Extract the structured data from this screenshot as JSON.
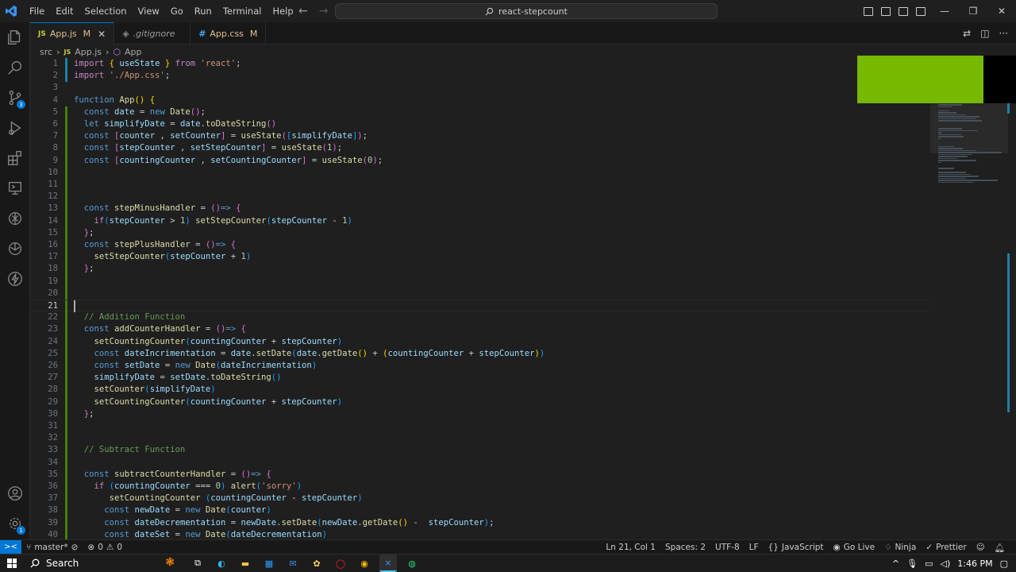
{
  "titlebar": {
    "menu": [
      "File",
      "Edit",
      "Selection",
      "View",
      "Go",
      "Run",
      "Terminal",
      "Help"
    ],
    "search_text": "react-stepcount"
  },
  "activitybar": {
    "icons": [
      "explorer-icon",
      "search-icon",
      "source-control-icon",
      "run-debug-icon",
      "extensions-icon",
      "remote-explorer-icon",
      "chatgpt-icon",
      "copilot-icon",
      "thunder-client-icon"
    ],
    "source_control_badge": "3",
    "bottom_icons": [
      "account-icon",
      "manage-gear-icon"
    ]
  },
  "tabs": [
    {
      "label": "App.js",
      "type": "JS",
      "modified": "M",
      "active": true
    },
    {
      "label": ".gitignore",
      "type": "git",
      "modified": "",
      "active": false
    },
    {
      "label": "App.css",
      "type": "#",
      "modified": "M",
      "active": false
    }
  ],
  "breadcrumb": {
    "folder": "src",
    "file": "App.js",
    "symbol": "App"
  },
  "editor": {
    "cursor_line": 21,
    "lines": [
      {
        "n": "1",
        "g": "mod",
        "t": [
          [
            "import ",
            "kw2"
          ],
          [
            "{ ",
            "br1"
          ],
          [
            "useState",
            "var"
          ],
          [
            " }",
            "br1"
          ],
          [
            " from ",
            "kw2"
          ],
          [
            "'react'",
            "str"
          ],
          [
            ";",
            "pn"
          ]
        ]
      },
      {
        "n": "2",
        "g": "mod",
        "t": [
          [
            "import ",
            "kw2"
          ],
          [
            "'./App.css'",
            "str"
          ],
          [
            ";",
            "pn"
          ]
        ]
      },
      {
        "n": "3",
        "g": "",
        "t": []
      },
      {
        "n": "4",
        "g": "",
        "t": [
          [
            "function ",
            "kw"
          ],
          [
            "App",
            "fn"
          ],
          [
            "() ",
            "br1"
          ],
          [
            "{",
            "br1"
          ]
        ]
      },
      {
        "n": "5",
        "g": "add",
        "t": [
          [
            "  const ",
            "kw"
          ],
          [
            "date",
            "var"
          ],
          [
            " = ",
            "pn"
          ],
          [
            "new ",
            "kw"
          ],
          [
            "Date",
            "fn"
          ],
          [
            "()",
            "br2"
          ],
          [
            ";",
            "pn"
          ]
        ]
      },
      {
        "n": "6",
        "g": "add",
        "t": [
          [
            "  let ",
            "kw"
          ],
          [
            "simplifyDate",
            "var"
          ],
          [
            " = ",
            "pn"
          ],
          [
            "date",
            "var"
          ],
          [
            ".",
            "pn"
          ],
          [
            "toDateString",
            "fn"
          ],
          [
            "()",
            "br2"
          ]
        ]
      },
      {
        "n": "7",
        "g": "add",
        "t": [
          [
            "  const ",
            "kw"
          ],
          [
            "[",
            "br2"
          ],
          [
            "counter",
            "var"
          ],
          [
            " , ",
            "pn"
          ],
          [
            "setCounter",
            "var"
          ],
          [
            "]",
            "br2"
          ],
          [
            " = ",
            "pn"
          ],
          [
            "useState",
            "fn"
          ],
          [
            "(",
            "br2"
          ],
          [
            "[",
            "br3"
          ],
          [
            "simplifyDate",
            "var"
          ],
          [
            "]",
            "br3"
          ],
          [
            ")",
            "br2"
          ],
          [
            ";",
            "pn"
          ]
        ]
      },
      {
        "n": "8",
        "g": "add",
        "t": [
          [
            "  const ",
            "kw"
          ],
          [
            "[",
            "br2"
          ],
          [
            "stepCounter",
            "var"
          ],
          [
            " , ",
            "pn"
          ],
          [
            "setStepCounter",
            "var"
          ],
          [
            "]",
            "br2"
          ],
          [
            " = ",
            "pn"
          ],
          [
            "useState",
            "fn"
          ],
          [
            "(",
            "br2"
          ],
          [
            "1",
            "num"
          ],
          [
            ")",
            "br2"
          ],
          [
            ";",
            "pn"
          ]
        ]
      },
      {
        "n": "9",
        "g": "add",
        "t": [
          [
            "  const ",
            "kw"
          ],
          [
            "[",
            "br2"
          ],
          [
            "countingCounter",
            "var"
          ],
          [
            " , ",
            "pn"
          ],
          [
            "setCountingCounter",
            "var"
          ],
          [
            "]",
            "br2"
          ],
          [
            " = ",
            "pn"
          ],
          [
            "useState",
            "fn"
          ],
          [
            "(",
            "br2"
          ],
          [
            "0",
            "num"
          ],
          [
            ")",
            "br2"
          ],
          [
            ";",
            "pn"
          ]
        ]
      },
      {
        "n": "10",
        "g": "add",
        "t": []
      },
      {
        "n": "11",
        "g": "add",
        "t": []
      },
      {
        "n": "12",
        "g": "add",
        "t": []
      },
      {
        "n": "13",
        "g": "add",
        "t": [
          [
            "  const ",
            "kw"
          ],
          [
            "stepMinusHandler",
            "fn"
          ],
          [
            " = ",
            "pn"
          ],
          [
            "()",
            "br2"
          ],
          [
            "=> ",
            "kw"
          ],
          [
            "{",
            "br2"
          ]
        ]
      },
      {
        "n": "14",
        "g": "add",
        "t": [
          [
            "    if",
            "kw2"
          ],
          [
            "(",
            "br3"
          ],
          [
            "stepCounter",
            "var"
          ],
          [
            " > ",
            "pn"
          ],
          [
            "1",
            "num"
          ],
          [
            ")",
            "br3"
          ],
          [
            " setStepCounter",
            "fn"
          ],
          [
            "(",
            "br3"
          ],
          [
            "stepCounter",
            "var"
          ],
          [
            " - ",
            "pn"
          ],
          [
            "1",
            "num"
          ],
          [
            ")",
            "br3"
          ]
        ]
      },
      {
        "n": "15",
        "g": "add",
        "t": [
          [
            "  ",
            "pn"
          ],
          [
            "}",
            "br2"
          ],
          [
            ";",
            "pn"
          ]
        ]
      },
      {
        "n": "16",
        "g": "add",
        "t": [
          [
            "  const ",
            "kw"
          ],
          [
            "stepPlusHandler",
            "fn"
          ],
          [
            " = ",
            "pn"
          ],
          [
            "()",
            "br2"
          ],
          [
            "=> ",
            "kw"
          ],
          [
            "{",
            "br2"
          ]
        ]
      },
      {
        "n": "17",
        "g": "add",
        "t": [
          [
            "    setStepCounter",
            "fn"
          ],
          [
            "(",
            "br3"
          ],
          [
            "stepCounter",
            "var"
          ],
          [
            " + ",
            "pn"
          ],
          [
            "1",
            "num"
          ],
          [
            ")",
            "br3"
          ]
        ]
      },
      {
        "n": "18",
        "g": "add",
        "t": [
          [
            "  ",
            "pn"
          ],
          [
            "}",
            "br2"
          ],
          [
            ";",
            "pn"
          ]
        ]
      },
      {
        "n": "19",
        "g": "add",
        "t": []
      },
      {
        "n": "20",
        "g": "add",
        "t": []
      },
      {
        "n": "21",
        "g": "add",
        "t": []
      },
      {
        "n": "22",
        "g": "add",
        "t": [
          [
            "  // Addition Function",
            "cmt"
          ]
        ]
      },
      {
        "n": "23",
        "g": "add",
        "t": [
          [
            "  const ",
            "kw"
          ],
          [
            "addCounterHandler",
            "fn"
          ],
          [
            " = ",
            "pn"
          ],
          [
            "()",
            "br2"
          ],
          [
            "=> ",
            "kw"
          ],
          [
            "{",
            "br2"
          ]
        ]
      },
      {
        "n": "24",
        "g": "add",
        "t": [
          [
            "    setCountingCounter",
            "fn"
          ],
          [
            "(",
            "br3"
          ],
          [
            "countingCounter",
            "var"
          ],
          [
            " + ",
            "pn"
          ],
          [
            "stepCounter",
            "var"
          ],
          [
            ")",
            "br3"
          ]
        ]
      },
      {
        "n": "25",
        "g": "add",
        "t": [
          [
            "    const ",
            "kw"
          ],
          [
            "dateIncrimentation",
            "var"
          ],
          [
            " = ",
            "pn"
          ],
          [
            "date",
            "var"
          ],
          [
            ".",
            "pn"
          ],
          [
            "setDate",
            "fn"
          ],
          [
            "(",
            "br3"
          ],
          [
            "date",
            "var"
          ],
          [
            ".",
            "pn"
          ],
          [
            "getDate",
            "fn"
          ],
          [
            "()",
            "br1"
          ],
          [
            " + ",
            "pn"
          ],
          [
            "(",
            "br1"
          ],
          [
            "countingCounter",
            "var"
          ],
          [
            " + ",
            "pn"
          ],
          [
            "stepCounter",
            "var"
          ],
          [
            ")",
            "br1"
          ],
          [
            ")",
            "br3"
          ]
        ]
      },
      {
        "n": "26",
        "g": "add",
        "t": [
          [
            "    const ",
            "kw"
          ],
          [
            "setDate",
            "var"
          ],
          [
            " = ",
            "pn"
          ],
          [
            "new ",
            "kw"
          ],
          [
            "Date",
            "fn"
          ],
          [
            "(",
            "br3"
          ],
          [
            "dateIncrimentation",
            "var"
          ],
          [
            ")",
            "br3"
          ]
        ]
      },
      {
        "n": "27",
        "g": "add",
        "t": [
          [
            "    simplifyDate",
            "var"
          ],
          [
            " = ",
            "pn"
          ],
          [
            "setDate",
            "var"
          ],
          [
            ".",
            "pn"
          ],
          [
            "toDateString",
            "fn"
          ],
          [
            "()",
            "br3"
          ]
        ]
      },
      {
        "n": "28",
        "g": "add",
        "t": [
          [
            "    setCounter",
            "fn"
          ],
          [
            "(",
            "br3"
          ],
          [
            "simplifyDate",
            "var"
          ],
          [
            ")",
            "br3"
          ]
        ]
      },
      {
        "n": "29",
        "g": "add",
        "t": [
          [
            "    setCountingCounter",
            "fn"
          ],
          [
            "(",
            "br3"
          ],
          [
            "countingCounter",
            "var"
          ],
          [
            " + ",
            "pn"
          ],
          [
            "stepCounter",
            "var"
          ],
          [
            ")",
            "br3"
          ]
        ]
      },
      {
        "n": "30",
        "g": "add",
        "t": [
          [
            "  ",
            "pn"
          ],
          [
            "}",
            "br2"
          ],
          [
            ";",
            "pn"
          ]
        ]
      },
      {
        "n": "31",
        "g": "add",
        "t": []
      },
      {
        "n": "32",
        "g": "add",
        "t": []
      },
      {
        "n": "33",
        "g": "add",
        "t": [
          [
            "  // Subtract Function",
            "cmt"
          ]
        ]
      },
      {
        "n": "34",
        "g": "add",
        "t": []
      },
      {
        "n": "35",
        "g": "add",
        "t": [
          [
            "  const ",
            "kw"
          ],
          [
            "subtractCounterHandler",
            "fn"
          ],
          [
            " = ",
            "pn"
          ],
          [
            "()",
            "br2"
          ],
          [
            "=> ",
            "kw"
          ],
          [
            "{",
            "br2"
          ]
        ]
      },
      {
        "n": "36",
        "g": "add",
        "t": [
          [
            "    if ",
            "kw2"
          ],
          [
            "(",
            "br3"
          ],
          [
            "countingCounter",
            "var"
          ],
          [
            " === ",
            "pn"
          ],
          [
            "0",
            "num"
          ],
          [
            ")",
            "br3"
          ],
          [
            " alert",
            "fn"
          ],
          [
            "(",
            "br3"
          ],
          [
            "'sorry'",
            "str"
          ],
          [
            ")",
            "br3"
          ]
        ]
      },
      {
        "n": "37",
        "g": "add",
        "t": [
          [
            "       setCountingCounter",
            "fn"
          ],
          [
            " (",
            "br3"
          ],
          [
            "countingCounter",
            "var"
          ],
          [
            " - ",
            "pn"
          ],
          [
            "stepCounter",
            "var"
          ],
          [
            ")",
            "br3"
          ]
        ]
      },
      {
        "n": "38",
        "g": "add",
        "t": [
          [
            "      const ",
            "kw"
          ],
          [
            "newDate",
            "var"
          ],
          [
            " = ",
            "pn"
          ],
          [
            "new ",
            "kw"
          ],
          [
            "Date",
            "fn"
          ],
          [
            "(",
            "br3"
          ],
          [
            "counter",
            "var"
          ],
          [
            ")",
            "br3"
          ]
        ]
      },
      {
        "n": "39",
        "g": "add",
        "t": [
          [
            "      const ",
            "kw"
          ],
          [
            "dateDecrementation",
            "var"
          ],
          [
            " = ",
            "pn"
          ],
          [
            "newDate",
            "var"
          ],
          [
            ".",
            "pn"
          ],
          [
            "setDate",
            "fn"
          ],
          [
            "(",
            "br3"
          ],
          [
            "newDate",
            "var"
          ],
          [
            ".",
            "pn"
          ],
          [
            "getDate",
            "fn"
          ],
          [
            "()",
            "br1"
          ],
          [
            " -  ",
            "pn"
          ],
          [
            "stepCounter",
            "var"
          ],
          [
            ")",
            "br3"
          ],
          [
            ";",
            "pn"
          ]
        ]
      },
      {
        "n": "40",
        "g": "add",
        "t": [
          [
            "      const ",
            "kw"
          ],
          [
            "dateSet",
            "var"
          ],
          [
            " = ",
            "pn"
          ],
          [
            "new ",
            "kw"
          ],
          [
            "Date",
            "fn"
          ],
          [
            "(",
            "br3"
          ],
          [
            "dateDecrementation",
            "var"
          ],
          [
            ")",
            "br3"
          ]
        ]
      }
    ]
  },
  "statusbar": {
    "branch": "master*",
    "problems": "0",
    "warnings": "0",
    "position": "Ln 21, Col 1",
    "spaces": "Spaces: 2",
    "encoding": "UTF-8",
    "eol": "LF",
    "language": "JavaScript",
    "golive": "Go Live",
    "ninja": "Ninja",
    "prettier": "Prettier"
  },
  "taskbar": {
    "search_label": "Search",
    "time": "1:46 PM"
  },
  "colors": {
    "accent": "#0078d4",
    "green_overlay": "#77b900",
    "modified": "#e2c08d"
  }
}
